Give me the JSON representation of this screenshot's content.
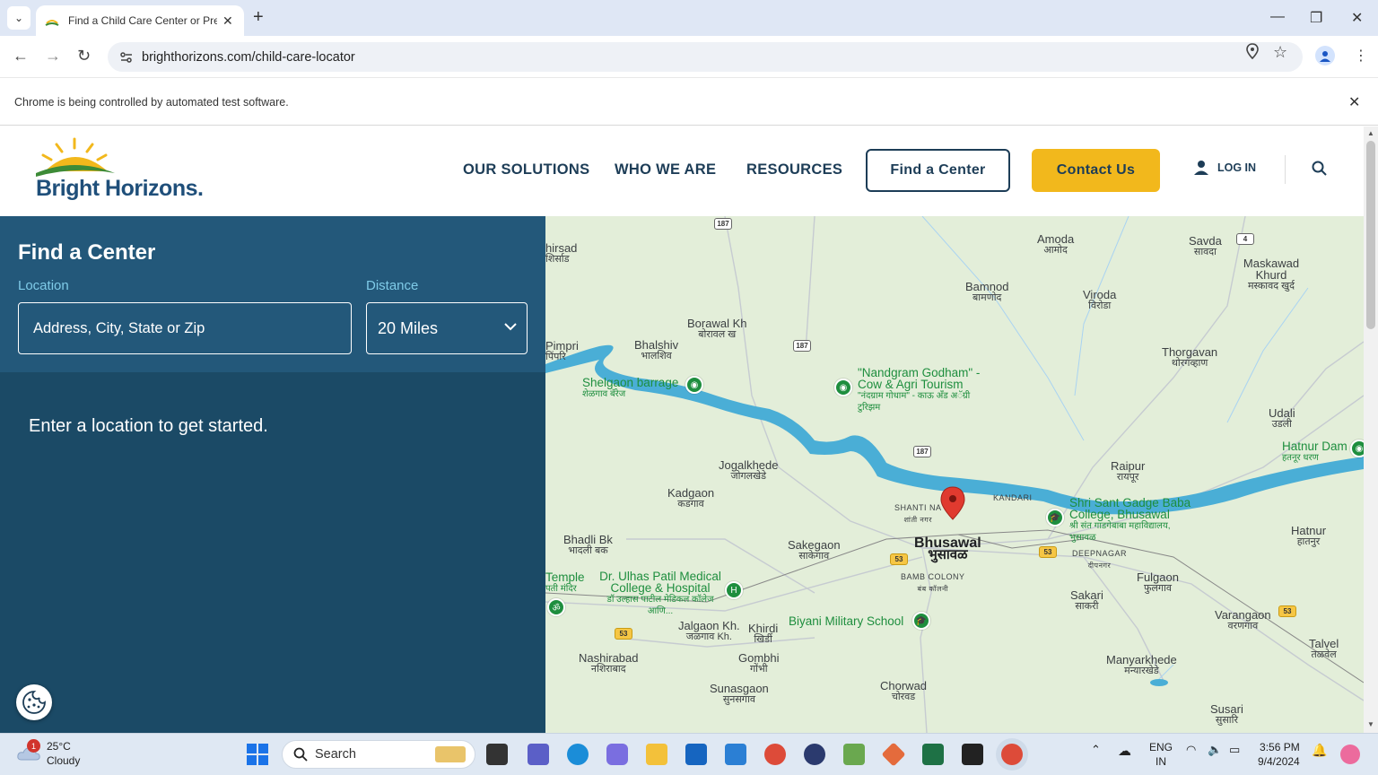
{
  "browser": {
    "tab_title": "Find a Child Care Center or Pres",
    "url": "brighthorizons.com/child-care-locator",
    "infobar_message": "Chrome is being controlled by automated test software."
  },
  "header": {
    "logo_text": "Bright Horizons.",
    "nav": [
      "OUR SOLUTIONS",
      "WHO WE ARE",
      "RESOURCES"
    ],
    "find_center_button": "Find a Center",
    "contact_button": "Contact Us",
    "login_label": "LOG IN"
  },
  "finder": {
    "title": "Find a Center",
    "location_label": "Location",
    "location_placeholder": "Address, City, State or Zip",
    "distance_label": "Distance",
    "distance_value": "20 Miles",
    "empty_message": "Enter a location to get started."
  },
  "map": {
    "labels": [
      {
        "name": "Hirsad",
        "text": "hirsad",
        "sub": "शिर्साड"
      },
      {
        "name": "Amoda",
        "text": "Amoda",
        "sub": "आमोद"
      },
      {
        "name": "Savda",
        "text": "Savda",
        "sub": "सावदा"
      },
      {
        "name": "Maskawad",
        "text": "Maskawad Khurd",
        "sub": "मस्कावद खुर्द"
      },
      {
        "name": "Bamnod",
        "text": "Bamnod",
        "sub": "बामणोद"
      },
      {
        "name": "Viroda",
        "text": "Viroda",
        "sub": "विरोडा"
      },
      {
        "name": "Borawal",
        "text": "Borawal Kh",
        "sub": "बोरावल ख"
      },
      {
        "name": "Pimpri",
        "text": "Pimpri",
        "sub": "पिंपरि"
      },
      {
        "name": "Bhalshiv",
        "text": "Bhalshiv",
        "sub": "भालशिव"
      },
      {
        "name": "Thorgavan",
        "text": "Thorgavan",
        "sub": "थोरगव्हाण"
      },
      {
        "name": "Udali",
        "text": "Udali",
        "sub": "उडली"
      },
      {
        "name": "Raipur",
        "text": "Raipur",
        "sub": "रायपूर"
      },
      {
        "name": "Jogalkhede",
        "text": "Jogalkhede",
        "sub": "जोगलखेडे"
      },
      {
        "name": "Kadgaon",
        "text": "Kadgaon",
        "sub": "कडगाव"
      },
      {
        "name": "Bhadli",
        "text": "Bhadli Bk",
        "sub": "भादली बक"
      },
      {
        "name": "Sakegaon",
        "text": "Sakegaon",
        "sub": "साकेगाव"
      },
      {
        "name": "Hatnur",
        "text": "Hatnur",
        "sub": "हातनुर"
      },
      {
        "name": "Fulgaon",
        "text": "Fulgaon",
        "sub": "फुलगाव"
      },
      {
        "name": "Sakari",
        "text": "Sakari",
        "sub": "साकरी"
      },
      {
        "name": "Varangaon",
        "text": "Varangaon",
        "sub": "वरणगाव"
      },
      {
        "name": "Talvel",
        "text": "Talvel",
        "sub": "तळवेल"
      },
      {
        "name": "Jalgaon",
        "text": "Jalgaon Kh.",
        "sub": "जळगाव Kh."
      },
      {
        "name": "Khirdi",
        "text": "Khirdi",
        "sub": "खिर्डी"
      },
      {
        "name": "Nashirabad",
        "text": "Nashirabad",
        "sub": "नशिराबाद"
      },
      {
        "name": "Gombhi",
        "text": "Gombhi",
        "sub": "गोंभी"
      },
      {
        "name": "Manyarkhede",
        "text": "Manyarkhede",
        "sub": "मन्यारखेडे"
      },
      {
        "name": "Sunasgaon",
        "text": "Sunasgaon",
        "sub": "सुनसगाव"
      },
      {
        "name": "Chorwad",
        "text": "Chorwad",
        "sub": "चोरवड"
      },
      {
        "name": "Susari",
        "text": "Susari",
        "sub": "सुसारि"
      },
      {
        "name": "Temple",
        "text": "Temple",
        "sub": "पती मंदिर"
      }
    ],
    "city": {
      "text": "Bhusawal",
      "sub": "भुसावळ"
    },
    "small_labels": [
      {
        "text": "SHANTI NA",
        "sub": "शांती नगर"
      },
      {
        "text": "KANDARI",
        "sub": ""
      },
      {
        "text": "DEEPNAGAR",
        "sub": "दीपनगर"
      },
      {
        "text": "BAMB COLONY",
        "sub": "बंब कॉलनी"
      }
    ],
    "pois": [
      {
        "text": "Shelgaon barrage",
        "sub": "शेळगाव बॅरेज"
      },
      {
        "text": "\"Nandgram Godham\" - Cow & Agri Tourism",
        "sub": "\"नंदग्राम गोधाम\" - काऊ अँड अॅग्री टुरिझम"
      },
      {
        "text": "Hatnur Dam",
        "sub": "हतनूर धरण"
      },
      {
        "text": "Shri Sant Gadge Baba College, Bhusawal",
        "sub": "श्री संत गाडगेबाबा महाविद्यालय, भुसावळ"
      },
      {
        "text": "Dr. Ulhas Patil Medical College & Hospital",
        "sub": "डॉ उल्हास पाटील मेडिकल कॉलेज आणि..."
      },
      {
        "text": "Biyani Military School",
        "sub": ""
      }
    ],
    "road_shields": [
      "187",
      "187",
      "187",
      "4",
      "53",
      "53",
      "53",
      "53"
    ]
  },
  "taskbar": {
    "weather_temp": "25°C",
    "weather_desc": "Cloudy",
    "weather_badge": "1",
    "search_label": "Search",
    "lang_1": "ENG",
    "lang_2": "IN",
    "time": "3:56 PM",
    "date": "9/4/2024"
  }
}
